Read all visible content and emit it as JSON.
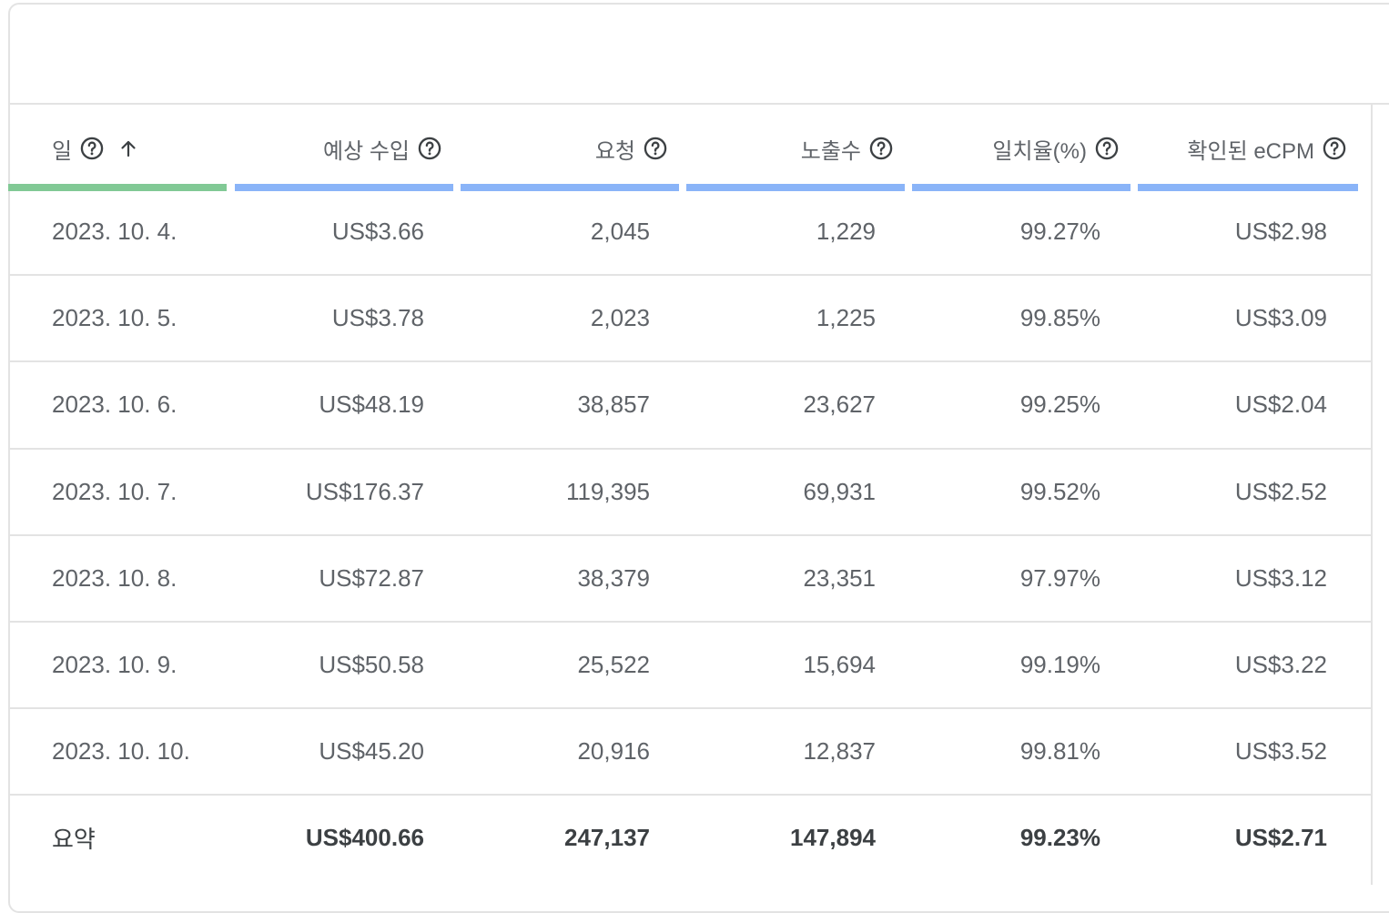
{
  "table": {
    "columns": [
      {
        "label": "일",
        "help_icon": "help-circle-icon",
        "sort_icon": "arrow-up-icon",
        "sorted": true
      },
      {
        "label": "예상 수입",
        "help_icon": "help-circle-icon"
      },
      {
        "label": "요청",
        "help_icon": "help-circle-icon"
      },
      {
        "label": "노출수",
        "help_icon": "help-circle-icon"
      },
      {
        "label": "일치율(%)",
        "help_icon": "help-circle-icon"
      },
      {
        "label": "확인된 eCPM",
        "help_icon": "help-circle-icon"
      }
    ],
    "rows": [
      [
        "2023. 10. 4.",
        "US$3.66",
        "2,045",
        "1,229",
        "99.27%",
        "US$2.98"
      ],
      [
        "2023. 10. 5.",
        "US$3.78",
        "2,023",
        "1,225",
        "99.85%",
        "US$3.09"
      ],
      [
        "2023. 10. 6.",
        "US$48.19",
        "38,857",
        "23,627",
        "99.25%",
        "US$2.04"
      ],
      [
        "2023. 10. 7.",
        "US$176.37",
        "119,395",
        "69,931",
        "99.52%",
        "US$2.52"
      ],
      [
        "2023. 10. 8.",
        "US$72.87",
        "38,379",
        "23,351",
        "97.97%",
        "US$3.12"
      ],
      [
        "2023. 10. 9.",
        "US$50.58",
        "25,522",
        "15,694",
        "99.19%",
        "US$3.22"
      ],
      [
        "2023. 10. 10.",
        "US$45.20",
        "20,916",
        "12,837",
        "99.81%",
        "US$3.52"
      ]
    ],
    "summary": [
      "요약",
      "US$400.66",
      "247,137",
      "147,894",
      "99.23%",
      "US$2.71"
    ]
  },
  "colors": {
    "sorted_column_bar": "#81c995",
    "column_bar": "#8ab4f8",
    "divider": "#e3e3e3",
    "text": "#5f6368"
  }
}
